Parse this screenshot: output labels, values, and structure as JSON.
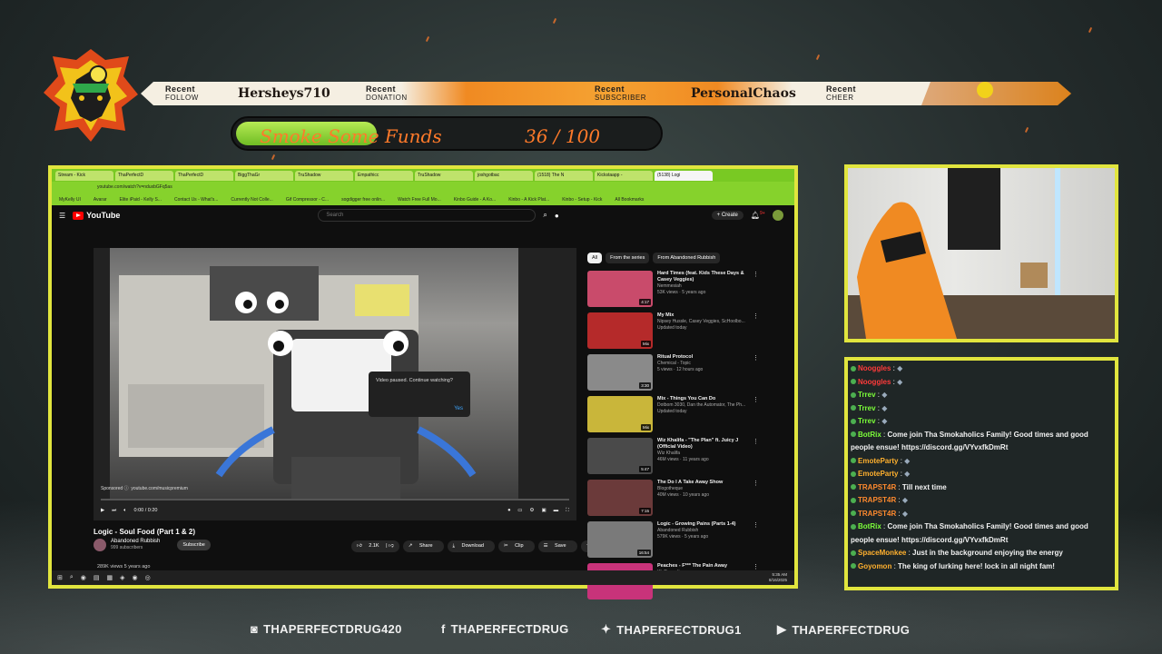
{
  "banner": {
    "recent_follow": {
      "line1": "Recent",
      "line2": "FOLLOW",
      "name": "Hersheys710"
    },
    "recent_donation": {
      "line1": "Recent",
      "line2": "DONATION",
      "name": ""
    },
    "recent_subscriber": {
      "line1": "Recent",
      "line2": "SUBSCRIBER",
      "name": "PersonalChaos"
    },
    "recent_cheer": {
      "line1": "Recent",
      "line2": "CHEER",
      "name": ""
    }
  },
  "goal": {
    "label": "Smoke Some Funds",
    "current": 36,
    "target": 100,
    "display": "36 / 100",
    "fraction": 0.36
  },
  "browser": {
    "tabs": [
      "Stream - Kick",
      "ThaPerfectD",
      "ThaPerfectD",
      "BiggThaGr",
      "TruShadow",
      "Empathicc",
      "TruShadow",
      "joshgotbac",
      "(1518) The N",
      "Kickstaapp -",
      "(5138) Logi"
    ],
    "url": "youtube.com/watch?v=nduxbGFq5as",
    "bookmarks": [
      "MyKelly UI",
      "Avarar",
      "Elite iPaid - Kelly S...",
      "Contact Us - What's...",
      "Currently Not Colle...",
      "Gif Compressor - C...",
      "sogdigger free onlin...",
      "Watch Free Full Mo...",
      "Kinbo Guide - A Ko...",
      "Kinbo - A Kick Plat...",
      "Kinbo - Setup - Kick",
      "All Bookmarks"
    ]
  },
  "youtube": {
    "logo": "YouTube",
    "search_placeholder": "Search",
    "create": "Create",
    "notif_count": "9+",
    "dialog": {
      "text": "Video paused. Continue watching?",
      "yes": "Yes"
    },
    "sponsored": "Sponsored",
    "sponsor_url": "youtube.com/musicpremium",
    "time": "0:00 / 0:20",
    "title": "Logic - Soul Food (Part 1 & 2)",
    "channel": "Abandoned Rubbish",
    "subs": "999 subscribers",
    "subscribe": "Subscribe",
    "likes": "2.1K",
    "share": "Share",
    "download": "Download",
    "clip": "Clip",
    "save": "Save",
    "views": "289K views  5 years ago",
    "chips": [
      "All",
      "From the series",
      "From Abandoned Rubbish"
    ],
    "recs": [
      {
        "title": "Hard Times (feat. Kids These Days & Casey Veggies)",
        "channel": "Nemmesiah",
        "meta": "53K views · 5 years ago",
        "dur": "4:17",
        "color": "#c94b6b"
      },
      {
        "title": "My Mix",
        "channel": "Nipsey Hussle, Casey Veggies, ScHoolbo...",
        "meta": "Updated today",
        "dur": "Mix",
        "color": "#b52a2a"
      },
      {
        "title": "Ritual Protocol",
        "channel": "Chemical - Topic",
        "meta": "5 views · 12 hours ago",
        "dur": "3:30",
        "color": "#8a8a8a"
      },
      {
        "title": "Mix - Things You Can Do",
        "channel": "Dotbom 3030, Dan the Automator, The Ph...",
        "meta": "Updated today",
        "dur": "Mix",
        "color": "#c9b63a"
      },
      {
        "title": "Wiz Khalifa - \"The Plan\" ft. Juicy J (Official Video)",
        "channel": "Wiz Khalifa",
        "meta": "46M views · 11 years ago",
        "dur": "5:47",
        "color": "#4a4a4a"
      },
      {
        "title": "The Do I A Take Away Show",
        "channel": "Blogotheque",
        "meta": "40M views · 10 years ago",
        "dur": "7:15",
        "color": "#6b3a3a"
      },
      {
        "title": "Logic - Growing Pains (Parts 1-4)",
        "channel": "Abandoned Rubbish",
        "meta": "579K views · 5 years ago",
        "dur": "16:54",
        "color": "#7a7a7a"
      },
      {
        "title": "Peaches - F*** The Pain Away",
        "channel": "XL Recordings",
        "meta": "",
        "dur": "",
        "color": "#c8337a"
      }
    ]
  },
  "taskbar": {
    "time": "5:35 AM",
    "date": "8/16/2025"
  },
  "chat": [
    {
      "user": "Nooggles",
      "text": "",
      "color": "#ff3a3a",
      "emote": true
    },
    {
      "user": "Nooggles",
      "text": "",
      "color": "#ff3a3a",
      "emote": true
    },
    {
      "user": "Trrev",
      "text": "",
      "color": "#7cff3a",
      "emote": true
    },
    {
      "user": "Trrev",
      "text": "",
      "color": "#7cff3a",
      "emote": true
    },
    {
      "user": "Trrev",
      "text": "",
      "color": "#7cff3a",
      "emote": true
    },
    {
      "user": "BotRix",
      "text": "Come join Tha Smokaholics Family! Good times and good people ensue! https://discord.gg/VYvxfkDmRt",
      "color": "#7cff3a",
      "emote": false
    },
    {
      "user": "EmoteParty",
      "text": "",
      "color": "#ffb02e",
      "emote": true
    },
    {
      "user": "EmoteParty",
      "text": "",
      "color": "#ffb02e",
      "emote": true
    },
    {
      "user": "TRAPST4R",
      "text": "Till next time",
      "color": "#ff8a2e",
      "emote": false
    },
    {
      "user": "TRAPST4R",
      "text": "",
      "color": "#ff8a2e",
      "emote": true
    },
    {
      "user": "TRAPST4R",
      "text": "",
      "color": "#ff8a2e",
      "emote": true
    },
    {
      "user": "BotRix",
      "text": "Come join Tha Smokaholics Family! Good times and good people ensue! https://discord.gg/VYvxfkDmRt",
      "color": "#7cff3a",
      "emote": false
    },
    {
      "user": "SpaceMonkee",
      "text": "Just in the background enjoying the energy",
      "color": "#ffb02e",
      "emote": false
    },
    {
      "user": "Goyomon",
      "text": "The king of lurking here! lock in all night fam!",
      "color": "#ffb02e",
      "emote": false
    }
  ],
  "social": {
    "instagram": "THAPERFECTDRUG420",
    "facebook": "THAPERFECTDRUG",
    "twitter": "THAPERFECTDRUG1",
    "youtube": "THAPERFECTDRUG"
  },
  "colors": {
    "frame": "#e1e53e",
    "accent": "#ff7a2a",
    "goal_fill": "#8fd43a"
  }
}
